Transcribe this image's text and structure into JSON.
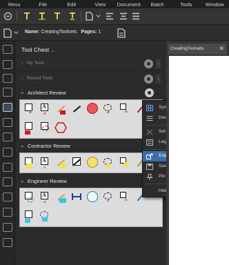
{
  "menubar": {
    "items": [
      "Revu",
      "File",
      "Edit",
      "View",
      "Document",
      "Batch",
      "Tools",
      "Window"
    ]
  },
  "toolbar2": {
    "name_label": "Name:",
    "name_value": "CreatingToolsets",
    "pages_label": "Pages:",
    "pages_value": "1"
  },
  "toolchest": {
    "title": "Tool Chest",
    "title_chevron": "⌄",
    "my_tools": "My Tools",
    "recent_tools": "Recent Tools",
    "sections": [
      {
        "label": "Architect Review",
        "chevron": "⌄"
      },
      {
        "label": "Contractor Review",
        "chevron": "⌄"
      },
      {
        "label": "Engineer Review",
        "chevron": "⌄"
      }
    ],
    "chevrons": {
      "collapsed": "›",
      "side": "›"
    },
    "tool_glyphs": {
      "text": "A",
      "callout_letter": "a"
    }
  },
  "document_tab": {
    "label": "CreatingToolsets",
    "close": "✕"
  },
  "context_menu": {
    "items": [
      {
        "label": "Symbol",
        "icon": "symbol-view-icon"
      },
      {
        "label": "Detail",
        "icon": "detail-view-icon"
      },
      {
        "label": "Set Scale...",
        "icon": "scale-icon"
      },
      {
        "label": "Legend",
        "icon": "legend-icon",
        "submenu": true
      },
      {
        "label": "Export",
        "icon": "export-icon",
        "selected": true
      },
      {
        "label": "Save",
        "icon": "save-icon"
      },
      {
        "label": "Pin",
        "icon": "pin-icon",
        "submenu": true
      },
      {
        "label": "Hide",
        "icon": ""
      }
    ],
    "submenu_arrow": "›"
  },
  "colors": {
    "accent_selected": "#3b6ea8",
    "toolset_bg": "#dcdcdc",
    "markup_red": "#d4161c",
    "markup_yellow": "#f2e14a",
    "markup_cyan": "#34c8e8"
  }
}
